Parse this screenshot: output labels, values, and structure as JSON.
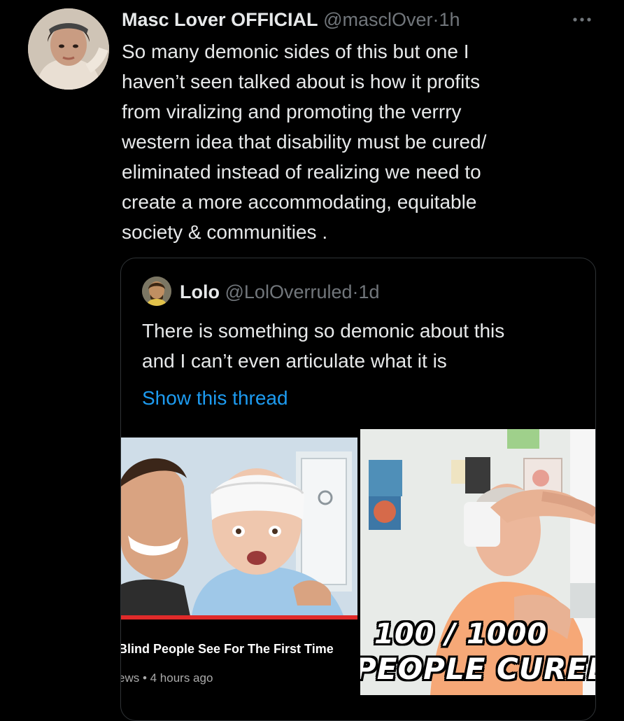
{
  "tweet": {
    "display_name": "Masc Lover OFFICIAL",
    "handle": "@masclOver",
    "separator": "·",
    "time": "1h",
    "text": "So many demonic sides of this but one I\nhaven’t seen talked about is how it profits\nfrom viralizing and promoting the verrry\nwestern idea that disability must be cured/\neliminated instead of realizing we need to\ncreate a more accommodating, equitable\nsociety & communities ."
  },
  "quote": {
    "display_name": "Lolo",
    "handle": "@LolOverruled",
    "separator": "·",
    "time": "1d",
    "text": "There is something so demonic about this\nand I can’t even articulate what it is",
    "show_thread": "Show this thread"
  },
  "media": {
    "left_video_title": "Blind People See For The First Time",
    "left_video_meta": "ews • 4 hours ago",
    "right_overlay_line1": "100 / 1000",
    "right_overlay_line2": "PEOPLE CURED"
  },
  "icons": {
    "more": "more-icon",
    "avatar": "avatar",
    "quote_avatar": "avatar"
  },
  "colors": {
    "background": "#000000",
    "text": "#e7e9ea",
    "secondary": "#71767b",
    "link": "#1d9bf0",
    "border": "#2f3336"
  }
}
